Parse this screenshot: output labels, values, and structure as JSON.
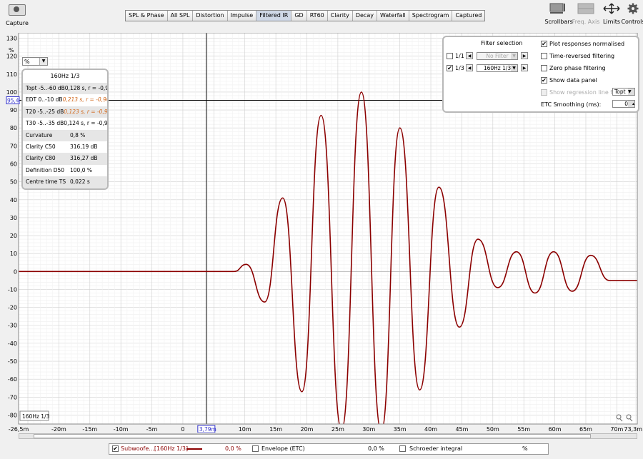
{
  "toolbar": {
    "capture_label": "Capture",
    "tabs": [
      "SPL & Phase",
      "All SPL",
      "Distortion",
      "Impulse",
      "Filtered IR",
      "GD",
      "RT60",
      "Clarity",
      "Decay",
      "Waterfall",
      "Spectrogram",
      "Captured"
    ],
    "active_tab": "Filtered IR",
    "scrollbars_label": "Scrollbars",
    "freq_axis_label": "Freq. Axis",
    "limits_label": "Limits",
    "controls_label": "Controls"
  },
  "plot": {
    "unit_label": "%",
    "unit_select": "%",
    "cursor_y_readout": "95,4",
    "cursor_x_readout": "3,79m",
    "plot_tag": "160Hz 1/3"
  },
  "data_panel": {
    "title": "160Hz 1/3",
    "rows": [
      {
        "label": "Topt -5..-60 dB",
        "value": "0,128 s,  r = -0,998",
        "highlight": false
      },
      {
        "label": "EDT  0..-10 dB",
        "value": "0,213 s,  r = -0,903",
        "highlight": true
      },
      {
        "label": "T20 -5..-25 dB",
        "value": "0,123 s,  r = -0,971",
        "highlight": true
      },
      {
        "label": "T30 -5..-35 dB",
        "value": "0,124 s,  r = -0,990",
        "highlight": false
      },
      {
        "label": "Curvature",
        "value": "0,8 %",
        "highlight": false
      },
      {
        "label": "Clarity C50",
        "value": "316,19 dB",
        "highlight": false
      },
      {
        "label": "Clarity C80",
        "value": "316,27 dB",
        "highlight": false
      },
      {
        "label": "Definition D50",
        "value": "100,0 %",
        "highlight": false
      },
      {
        "label": "Centre time TS",
        "value": "0,022 s",
        "highlight": false
      }
    ]
  },
  "filter_panel": {
    "title": "Filter selection",
    "opt_1_1": "1/1",
    "opt_1_3": "1/3",
    "no_filter": "No Filter",
    "filter_value": "160Hz 1/3",
    "plot_normalised": "Plot responses normalised",
    "time_reversed": "Time-reversed filtering",
    "zero_phase": "Zero phase filtering",
    "show_data_panel": "Show data panel",
    "show_regression": "Show regression line for",
    "regression_value": "Topt",
    "etc_smoothing_label": "ETC Smoothing (ms):",
    "etc_smoothing_value": "0"
  },
  "legend": {
    "series_label": "Subwoofe...[160Hz 1/3]",
    "series_value": "0,0 %",
    "envelope_label": "Envelope (ETC)",
    "envelope_value": "0,0 %",
    "schroeder_label": "Schroeder integral",
    "schroeder_value": "%"
  },
  "colors": {
    "series": "#8b0000",
    "grid": "#d8d8d8",
    "plot_bg": "#ffffff",
    "cursor": "#000000"
  },
  "chart_data": {
    "type": "line",
    "title": "",
    "xlabel": "",
    "ylabel": "%",
    "xlim": [
      -26.5,
      73.3
    ],
    "ylim": [
      -85,
      133
    ],
    "x_ticks": [
      "-26,5m",
      "-20m",
      "-15m",
      "-10m",
      "-5m",
      "0",
      "3,79m",
      "10m",
      "15m",
      "20m",
      "25m",
      "30m",
      "35m",
      "40m",
      "45m",
      "50m",
      "55m",
      "60m",
      "65m",
      "70m",
      "73,3m"
    ],
    "y_ticks": [
      "130",
      "120",
      "110",
      "100",
      "90",
      "80",
      "70",
      "60",
      "50",
      "40",
      "30",
      "20",
      "10",
      "0",
      "-10",
      "-20",
      "-30",
      "-40",
      "-50",
      "-60",
      "-70",
      "-80"
    ],
    "grid": true,
    "cursor": {
      "x": 3.79,
      "y": 95.4
    },
    "series": [
      {
        "name": "Subwoofe...[160Hz 1/3]",
        "x": [
          -26.5,
          8.3,
          10.2,
          13.2,
          16.1,
          19.2,
          22.3,
          25.6,
          28.8,
          32.0,
          35.0,
          38.2,
          41.3,
          44.6,
          47.6,
          50.8,
          53.8,
          56.8,
          59.8,
          62.8,
          65.8,
          68.8,
          72.0,
          73.3
        ],
        "y": [
          0,
          0,
          4,
          -17,
          41,
          -67,
          87,
          -88,
          100,
          -89,
          80,
          -66,
          47,
          -31,
          18,
          -9,
          11,
          -12,
          11,
          -11,
          9,
          -5,
          -5,
          -5
        ]
      }
    ]
  }
}
